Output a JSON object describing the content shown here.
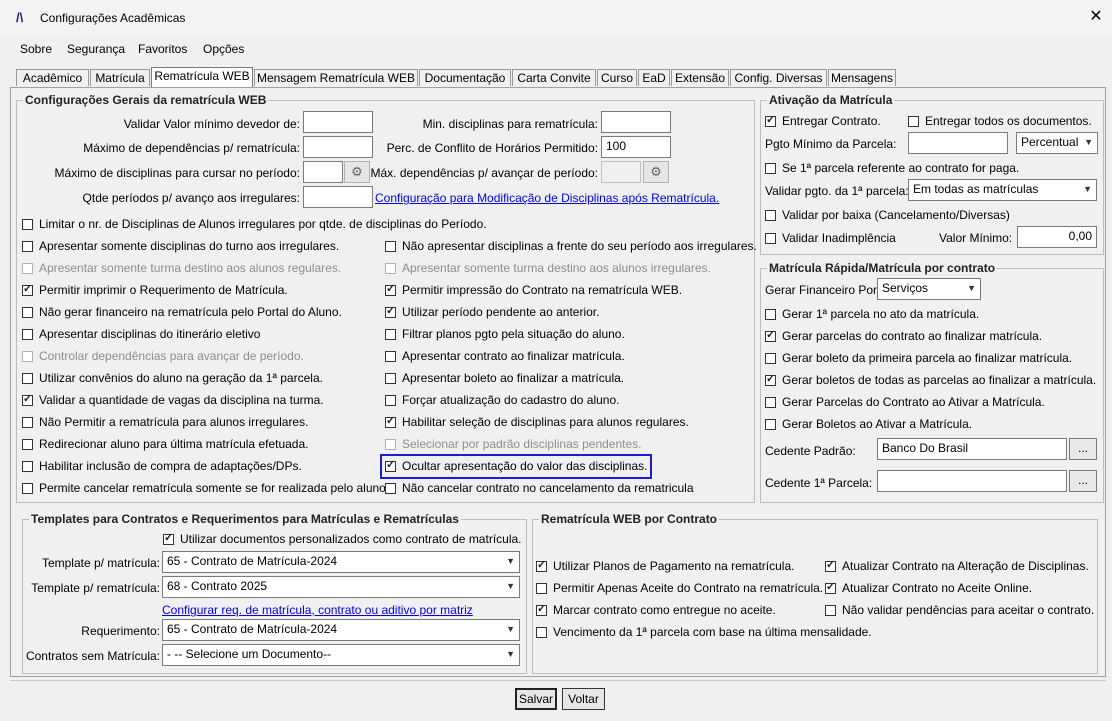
{
  "window": {
    "title": "Configurações Acadêmicas",
    "close": "✕",
    "logo": "/\\"
  },
  "menu": [
    "Sobre",
    "Segurança",
    "Favoritos",
    "Opções"
  ],
  "tabs": [
    "Acadêmico",
    "Matrícula",
    "Rematrícula WEB",
    "Mensagem Rematrícula WEB",
    "Documentação",
    "Carta Convite",
    "Curso",
    "EaD",
    "Extensão",
    "Config. Diversas",
    "Mensagens"
  ],
  "geral": {
    "legend": "Configurações Gerais da rematrícula WEB",
    "validar_valor": "Validar Valor mínimo devedor de:",
    "max_dependencias": "Máximo de dependências p/ rematrícula:",
    "max_disciplinas": "Máximo de disciplinas para cursar no período:",
    "qtde_periodos": "Qtde períodos p/ avanço aos irregulares:",
    "min_disciplinas": "Min. disciplinas para rematrícula:",
    "perc_conflito": "Perc. de Conflito de Horários Permitido:",
    "perc_conflito_value": "100",
    "max_dep_avancar": "Máx. dependências p/ avançar de período:",
    "link_config": "Configuração para Modificação de Disciplinas após Rematrícula.",
    "limitar": "Limitar o nr. de Disciplinas de Alunos irregulares por qtde. de disciplinas do Período.",
    "left_checks": [
      {
        "label": "Apresentar somente disciplinas do turno aos irregulares.",
        "checked": false,
        "disabled": false
      },
      {
        "label": "Apresentar somente turma destino aos alunos regulares.",
        "checked": false,
        "disabled": true
      },
      {
        "label": "Permitir imprimir o Requerimento de Matrícula.",
        "checked": true,
        "disabled": false
      },
      {
        "label": "Não gerar financeiro na rematrícula pelo Portal do Aluno.",
        "checked": false,
        "disabled": false
      },
      {
        "label": "Apresentar disciplinas do itinerário eletivo",
        "checked": false,
        "disabled": false
      },
      {
        "label": "Controlar dependências para avançar de período.",
        "checked": false,
        "disabled": true
      },
      {
        "label": "Utilizar convênios do aluno na geração da 1ª parcela.",
        "checked": false,
        "disabled": false
      },
      {
        "label": "Validar a quantidade de vagas da disciplina na turma.",
        "checked": true,
        "disabled": false
      },
      {
        "label": "Não Permitir a rematrícula para alunos irregulares.",
        "checked": false,
        "disabled": false
      },
      {
        "label": "Redirecionar aluno para última matrícula efetuada.",
        "checked": false,
        "disabled": false
      },
      {
        "label": "Habilitar inclusão de compra de adaptações/DPs.",
        "checked": false,
        "disabled": false
      },
      {
        "label": "Permite cancelar rematrícula somente se for realizada pelo aluno.",
        "checked": false,
        "disabled": false
      }
    ],
    "right_checks": [
      {
        "label": "Não apresentar disciplinas a frente do seu período aos irregulares.",
        "checked": false,
        "disabled": false
      },
      {
        "label": "Apresentar somente turma destino aos alunos irregulares.",
        "checked": false,
        "disabled": true
      },
      {
        "label": "Permitir impressão do Contrato na rematrícula WEB.",
        "checked": true,
        "disabled": false
      },
      {
        "label": "Utilizar período pendente ao anterior.",
        "checked": true,
        "disabled": false
      },
      {
        "label": "Filtrar planos pgto pela situação do aluno.",
        "checked": false,
        "disabled": false
      },
      {
        "label": "Apresentar contrato ao finalizar matrícula.",
        "checked": false,
        "disabled": false
      },
      {
        "label": "Apresentar boleto ao finalizar a matrícula.",
        "checked": false,
        "disabled": false
      },
      {
        "label": "Forçar atualização do cadastro do aluno.",
        "checked": false,
        "disabled": false
      },
      {
        "label": "Habilitar seleção de disciplinas para alunos regulares.",
        "checked": true,
        "disabled": false
      },
      {
        "label": "Selecionar por padrão disciplinas pendentes.",
        "checked": false,
        "disabled": true
      },
      {
        "label": "Ocultar apresentação do valor das disciplinas.",
        "checked": true,
        "disabled": false
      },
      {
        "label": "Não cancelar contrato no cancelamento da rematricula",
        "checked": false,
        "disabled": false
      }
    ]
  },
  "ativacao": {
    "legend": "Ativação da Matrícula",
    "entregar_contrato": "Entregar Contrato.",
    "entregar_todos": "Entregar todos os documentos.",
    "pgto_minimo": "Pgto Mínimo da Parcela:",
    "percentual": "Percentual",
    "se_primeira": "Se 1ª parcela referente ao contrato for paga.",
    "validar_pgto": "Validar pgto. da 1ª parcela:",
    "validar_pgto_value": "Em todas as matrículas",
    "validar_baixa": "Validar por baixa (Cancelamento/Diversas)",
    "validar_inad": "Validar Inadimplência",
    "valor_minimo": "Valor Mínimo:",
    "valor_minimo_value": "0,00"
  },
  "rapida": {
    "legend": "Matrícula Rápida/Matrícula por contrato",
    "gerar_fin": "Gerar Financeiro Por:",
    "gerar_fin_value": "Serviços",
    "checks": [
      {
        "label": "Gerar 1ª parcela no ato da matrícula.",
        "checked": false
      },
      {
        "label": "Gerar parcelas do contrato ao finalizar matrícula.",
        "checked": true
      },
      {
        "label": "Gerar boleto da primeira parcela ao finalizar matrícula.",
        "checked": false
      },
      {
        "label": "Gerar boletos de todas as parcelas ao finalizar a matrícula.",
        "checked": true
      },
      {
        "label": "Gerar Parcelas do Contrato ao Ativar a Matrícula.",
        "checked": false
      },
      {
        "label": "Gerar Boletos ao Ativar a Matrícula.",
        "checked": false
      }
    ],
    "cedente_padrao": "Cedente Padrão:",
    "cedente_padrao_value": "Banco Do Brasil",
    "cedente_1a": "Cedente 1ª Parcela:",
    "dots": "..."
  },
  "templates": {
    "legend": "Templates para Contratos e Requerimentos para Matrículas e Rematrículas",
    "utilizar_docs": "Utilizar documentos personalizados como contrato de matrícula.",
    "tpl_matricula": "Template p/ matrícula:",
    "tpl_matricula_value": "65 - Contrato de Matrícula-2024",
    "tpl_rematricula": "Template p/ rematrícula:",
    "tpl_rematricula_value": "68 - Contrato 2025",
    "link": "Configurar req. de matrícula, contrato ou aditivo por matriz",
    "requerimento": "Requerimento:",
    "requerimento_value": "65 - Contrato de Matrícula-2024",
    "contratos_sem": "Contratos sem Matrícula:",
    "contratos_sem_value": "- -- Selecione um Documento--"
  },
  "webcontrato": {
    "legend": "Rematrícula WEB por Contrato",
    "c1": "Utilizar Planos de Pagamento na rematrícula.",
    "c2": "Permitir Apenas Aceite do Contrato na rematrícula.",
    "c3": "Marcar contrato como entregue no aceite.",
    "c4": "Vencimento da 1ª parcela com base na última mensalidade.",
    "c5": "Atualizar Contrato na Alteração de Disciplinas.",
    "c6": "Atualizar Contrato no Aceite Online.",
    "c7": "Não validar pendências para aceitar o contrato."
  },
  "buttons": {
    "save": "Salvar",
    "back": "Voltar"
  }
}
